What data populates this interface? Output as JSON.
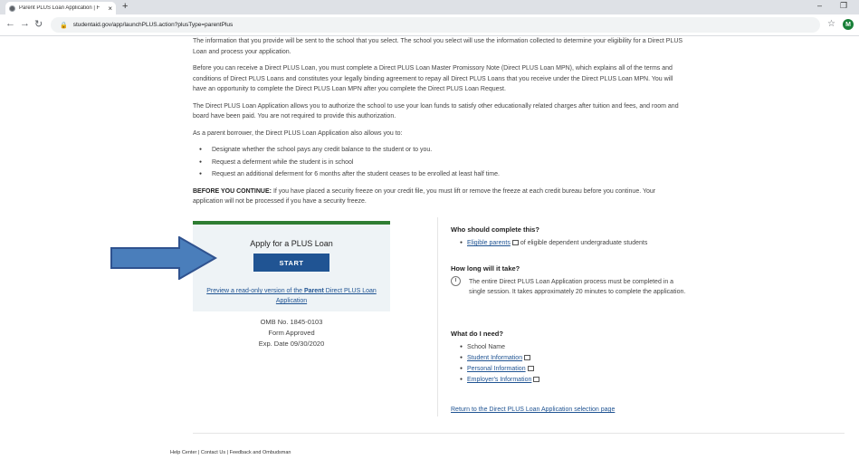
{
  "browser": {
    "tab_title": "Parent PLUS Loan Application | F",
    "tab_close": "×",
    "new_tab": "+",
    "minimize": "–",
    "maximize": "❐",
    "url": "studentaid.gov/app/launchPLUS.action?plusType=parentPlus",
    "profile_initial": "M"
  },
  "intro": {
    "p1": "The information that you provide will be sent to the school that you select. The school you select will use the information collected to determine your eligibility for a Direct PLUS Loan and process your application.",
    "p2": "Before you can receive a Direct PLUS Loan, you must complete a Direct PLUS Loan Master Promissory Note (Direct PLUS Loan MPN), which explains all of the terms and conditions of Direct PLUS Loans and constitutes your legally binding agreement to repay all Direct PLUS Loans that you receive under the Direct PLUS Loan MPN. You will have an opportunity to complete the Direct PLUS Loan MPN after you complete the Direct PLUS Loan Request.",
    "p3": "The Direct PLUS Loan Application allows you to authorize the school to use your loan funds to satisfy other educationally related charges after tuition and fees, and room and board have been paid. You are not required to provide this authorization.",
    "p4": "As a parent borrower, the Direct PLUS Loan Application also allows you to:",
    "bullets": [
      "Designate whether the school pays any credit balance to the student or to you.",
      "Request a deferment while the student is in school",
      "Request an additional deferment for 6 months after the student ceases to be enrolled at least half time."
    ],
    "before_label": "BEFORE YOU CONTINUE:",
    "before_text": " If you have placed a security freeze on your credit file, you must lift or remove the freeze at each credit bureau before you continue. Your application will not be processed if you have a security freeze."
  },
  "apply": {
    "title": "Apply for a PLUS Loan",
    "start_label": "START",
    "preview_pre": "Preview a read-only version of the ",
    "preview_bold": "Parent",
    "preview_post": " Direct PLUS Loan Application"
  },
  "omb": {
    "line1": "OMB No. 1845-0103",
    "line2": "Form Approved",
    "line3": "Exp. Date 09/30/2020"
  },
  "who": {
    "heading": "Who should complete this?",
    "link": "Eligible parents",
    "rest": " of eligible dependent undergraduate students"
  },
  "how_long": {
    "heading": "How long will it take?",
    "text": "The entire Direct PLUS Loan Application process must be completed in a single session. It takes approximately 20 minutes to complete the application."
  },
  "need": {
    "heading": "What do I need?",
    "plain_item": "School Name",
    "links": [
      "Student Information",
      "Personal Information",
      "Employer's Information"
    ]
  },
  "return_link": "Return to the Direct PLUS Loan Application selection page",
  "footer": {
    "help": "Help Center",
    "contact": "Contact Us",
    "feedback": "Feedback and Ombudsman",
    "sep": "|"
  },
  "colors": {
    "arrow": "#4a7ebb",
    "arrow_border": "#2f528f",
    "start_button": "#205493",
    "box_top": "#2e7d32"
  }
}
